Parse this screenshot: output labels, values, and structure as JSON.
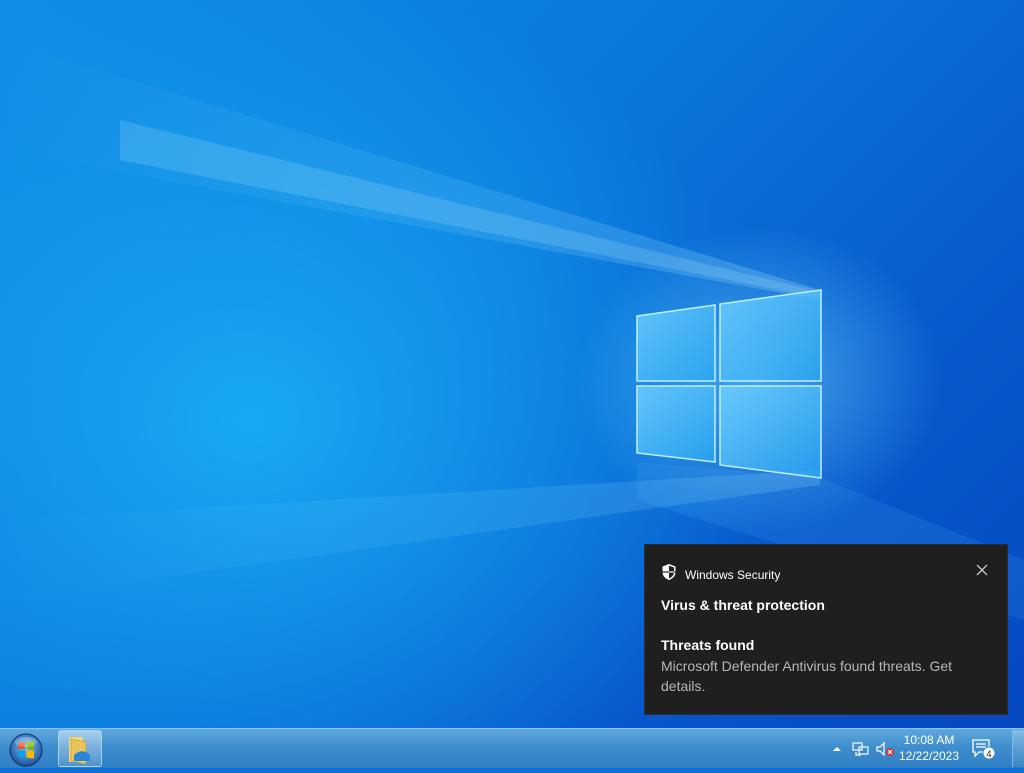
{
  "desktop": {
    "wallpaper": "windows-10-hero"
  },
  "toast": {
    "app_name": "Windows Security",
    "title": "Virus & threat protection",
    "heading": "Threats found",
    "body": "Microsoft Defender Antivirus found threats. Get details.",
    "icon": "shield-icon"
  },
  "taskbar": {
    "pinned": [
      {
        "name": "file-explorer",
        "icon": "folder-icon"
      }
    ],
    "tray": {
      "time": "10:08 AM",
      "date": "12/22/2023",
      "notification_count": "4"
    }
  },
  "colors": {
    "toast_bg": "#1f1f1f",
    "taskbar": "#3f8fcf",
    "accent": "#0a78dc"
  }
}
